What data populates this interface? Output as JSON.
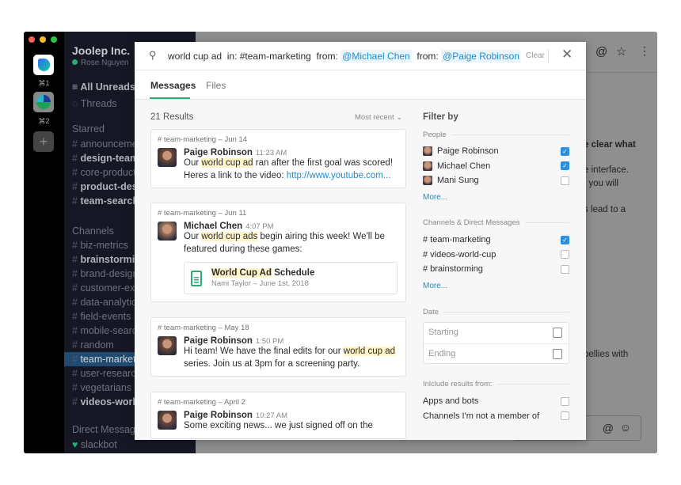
{
  "workspaces": [
    {
      "shortcut": "⌘1"
    },
    {
      "shortcut": "⌘2"
    }
  ],
  "sidebar": {
    "team": "Joolep Inc.",
    "user": "Rose Nguyen",
    "all_unreads": "All Unreads",
    "threads": "Threads",
    "starred_label": "Starred",
    "starred": [
      {
        "name": "announceme",
        "bold": false
      },
      {
        "name": "design-team",
        "bold": true
      },
      {
        "name": "core-product",
        "bold": false
      },
      {
        "name": "product-des",
        "bold": true
      },
      {
        "name": "team-search",
        "bold": true
      }
    ],
    "channels_label": "Channels",
    "channels": [
      {
        "name": "biz-metrics",
        "bold": false
      },
      {
        "name": "brainstormin",
        "bold": true
      },
      {
        "name": "brand-design",
        "bold": false
      },
      {
        "name": "customer-ex",
        "bold": false
      },
      {
        "name": "data-analytic",
        "bold": false
      },
      {
        "name": "field-events",
        "bold": false
      },
      {
        "name": "mobile-searc",
        "bold": false
      },
      {
        "name": "random",
        "bold": false
      },
      {
        "name": "team-market",
        "bold": false,
        "selected": true
      },
      {
        "name": "user-researc",
        "bold": false
      },
      {
        "name": "vegetarians",
        "bold": false
      },
      {
        "name": "videos-worl",
        "bold": true
      }
    ],
    "dm_label": "Direct Message",
    "dms": [
      "slackbot"
    ]
  },
  "main": {
    "snippets": [
      "e clear what",
      "e interface.",
      ", you will",
      "s lead to a",
      "bellies with"
    ]
  },
  "search": {
    "query": "world cup ad",
    "in_label": "in:",
    "in_value": "#team-marketing",
    "from_label": "from:",
    "from1": "@Michael Chen",
    "from2": "@Paige Robinson",
    "clear": "Clear"
  },
  "tabs": [
    "Messages",
    "Files"
  ],
  "results": {
    "count": "21 Results",
    "sort": "Most recent",
    "items": [
      {
        "channel": "# team-marketing",
        "date": "Jun 14",
        "author": "Paige Robinson",
        "time": "11:23 AM",
        "pre": "Our ",
        "hl": "world cup ad",
        "post": " ran after the first goal was scored! Heres a link to the video: ",
        "link": "http://www.youtube.com..."
      },
      {
        "channel": "# team-marketing",
        "date": "Jun 11",
        "author": "Michael Chen",
        "time": "4:07 PM",
        "pre": "Our ",
        "hl": "world cup ads",
        "post": " begin airing this week! We'll be featured during these games:",
        "file": {
          "title_hl": "World Cup Ad",
          "title_rest": " Schedule",
          "meta": "Nami Taylor – June 1st, 2018"
        }
      },
      {
        "channel": "# team-marketing",
        "date": "May 18",
        "author": "Paige Robinson",
        "time": "1:50 PM",
        "pre": "Hi team! We have the final edits for our ",
        "hl": "world cup ad",
        "post": " series. Join us at 3pm for a screening party."
      },
      {
        "channel": "# team-marketing",
        "date": "April 2",
        "author": "Paige Robinson",
        "time": "10:27 AM",
        "pre": "Some exciting news... we just signed off on the",
        "hl": "",
        "post": ""
      }
    ]
  },
  "filter": {
    "title": "Filter by",
    "people_label": "People",
    "people": [
      {
        "name": "Paige Robinson",
        "checked": true
      },
      {
        "name": "Michael Chen",
        "checked": true
      },
      {
        "name": "Mani Sung",
        "checked": false
      }
    ],
    "more": "More...",
    "channels_label": "Channels & Direct Messages",
    "channels": [
      {
        "name": "# team-marketing",
        "checked": true
      },
      {
        "name": "# videos-world-cup",
        "checked": false
      },
      {
        "name": "# brainstorming",
        "checked": false
      }
    ],
    "date_label": "Date",
    "starting": "Starting",
    "ending": "Ending",
    "include_label": "Inlclude results from:",
    "include": [
      {
        "name": "Apps and bots",
        "checked": false
      },
      {
        "name": "Channels I'm not a member of",
        "checked": false
      }
    ]
  }
}
